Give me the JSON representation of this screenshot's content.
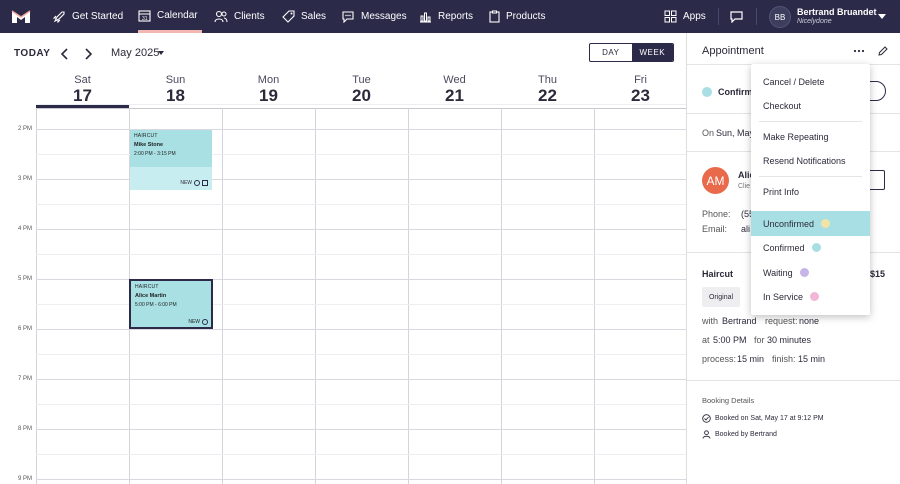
{
  "nav": {
    "items": [
      {
        "label": "Get Started"
      },
      {
        "label": "Calendar"
      },
      {
        "label": "Clients"
      },
      {
        "label": "Sales"
      },
      {
        "label": "Messages"
      },
      {
        "label": "Reports"
      },
      {
        "label": "Products"
      },
      {
        "label": "Apps"
      }
    ],
    "active": "Calendar",
    "user": {
      "initials": "BB",
      "name": "Bertrand Bruandet",
      "org": "Nicelydone"
    }
  },
  "calendar": {
    "today_label": "TODAY",
    "month_label": "May 2025",
    "view_day": "DAY",
    "view_week": "WEEK",
    "active_view": "WEEK",
    "days": [
      {
        "dow": "Sat",
        "num": "17"
      },
      {
        "dow": "Sun",
        "num": "18"
      },
      {
        "dow": "Mon",
        "num": "19"
      },
      {
        "dow": "Tue",
        "num": "20"
      },
      {
        "dow": "Wed",
        "num": "21"
      },
      {
        "dow": "Thu",
        "num": "22"
      },
      {
        "dow": "Fri",
        "num": "23"
      }
    ],
    "selected_day": "17",
    "hours": [
      "2 PM",
      "3 PM",
      "4 PM",
      "5 PM",
      "6 PM",
      "7 PM",
      "8 PM",
      "9 PM"
    ],
    "appointments": [
      {
        "service": "HAIRCUT",
        "client": "Mike Stone",
        "time": "2:00 PM - 3:15 PM",
        "badge": "NEW"
      },
      {
        "service": "HAIRCUT",
        "client": "Alice Martin",
        "time": "5:00 PM - 6:00 PM",
        "badge": "NEW"
      }
    ]
  },
  "panel": {
    "title": "Appointment",
    "status": "Confirm",
    "on_label": "On",
    "on_value": "Sun, May",
    "customer_initials": "AM",
    "customer_name": "Alic",
    "customer_sub": "Clie",
    "phone_label": "Phone:",
    "phone_value": "(55",
    "email_label": "Email:",
    "email_value": "ali",
    "service": "Haircut",
    "price": "$15",
    "original_label": "Original",
    "with_label": "with",
    "with_value": "Bertrand",
    "request_label": "request:",
    "request_value": "none",
    "at_label": "at",
    "at_value": "5:00 PM",
    "for_label": "for",
    "for_value": "30 minutes",
    "process_label": "process:",
    "process_value": "15 min",
    "finish_label": "finish:",
    "finish_value": "15 min",
    "booking_details_label": "Booking Details",
    "booked_on": "Booked on Sat, May 17 at 9:12 PM",
    "booked_by": "Booked by Bertrand"
  },
  "menu": {
    "items": [
      {
        "label": "Cancel / Delete"
      },
      {
        "label": "Checkout"
      },
      {
        "label": "Make Repeating"
      },
      {
        "label": "Resend Notifications"
      },
      {
        "label": "Print Info"
      },
      {
        "label": "Unconfirmed"
      },
      {
        "label": "Confirmed"
      },
      {
        "label": "Waiting"
      },
      {
        "label": "In Service"
      }
    ],
    "selected": "Unconfirmed"
  },
  "colors": {
    "nav_bg": "#2b2b49",
    "appt_fill": "#a8e0e4",
    "unconfirmed": "#f2e4a6",
    "confirmed": "#a8dfe4",
    "waiting": "#c8b5e8",
    "in_service": "#f0b7d6",
    "avatar": "#e96a4a"
  }
}
